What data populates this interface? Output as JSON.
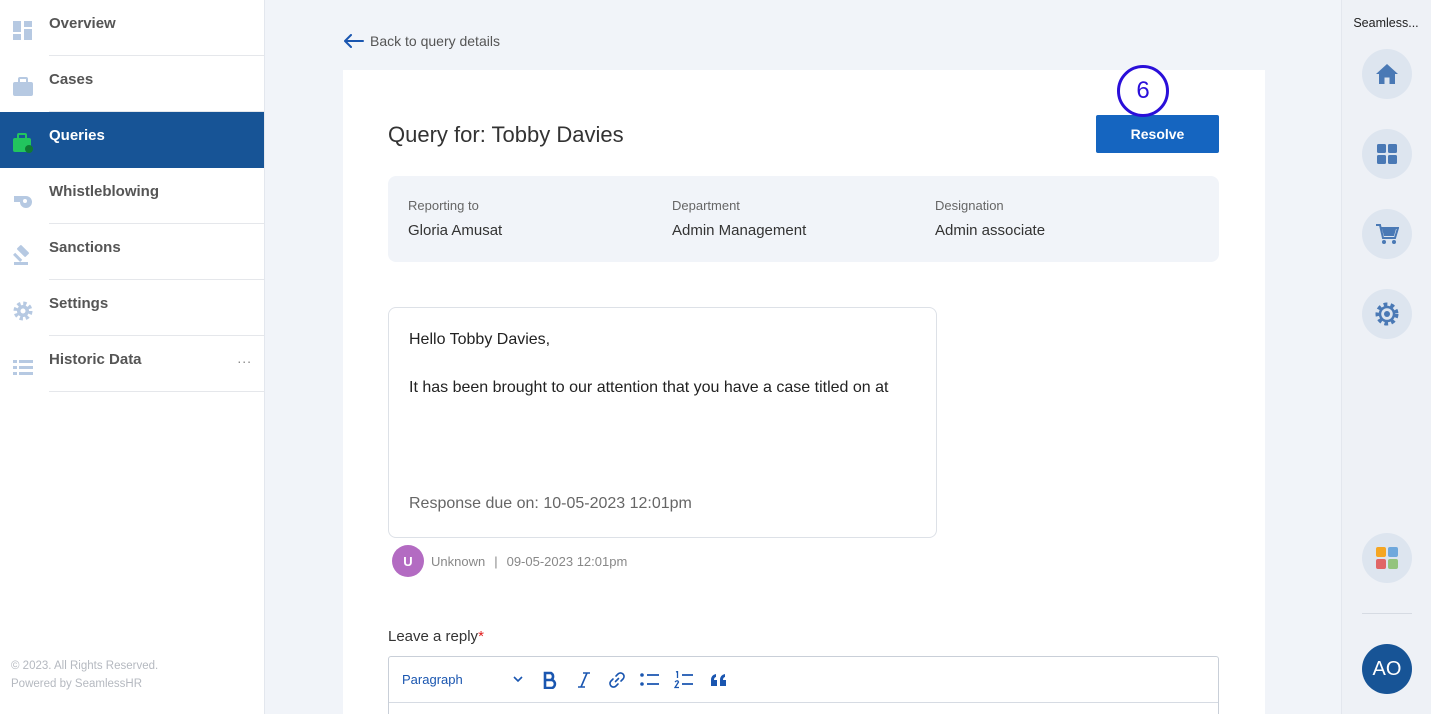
{
  "sidebar": {
    "items": [
      {
        "label": "Overview",
        "icon": "dashboard-icon",
        "active": false
      },
      {
        "label": "Cases",
        "icon": "briefcase-icon",
        "active": false
      },
      {
        "label": "Queries",
        "icon": "query-briefcase-icon",
        "active": true
      },
      {
        "label": "Whistleblowing",
        "icon": "whistle-icon",
        "active": false
      },
      {
        "label": "Sanctions",
        "icon": "gavel-icon",
        "active": false
      },
      {
        "label": "Settings",
        "icon": "gear-icon",
        "active": false
      },
      {
        "label": "Historic Data",
        "icon": "list-icon",
        "active": false,
        "more": "..."
      }
    ],
    "footer": {
      "copyright": "© 2023. All Rights Reserved.",
      "powered": "Powered by SeamlessHR"
    }
  },
  "header": {
    "back_label": "Back to query details"
  },
  "query": {
    "title": "Query for: Tobby Davies",
    "resolve_label": "Resolve",
    "step_badge": "6",
    "info": [
      {
        "label": "Reporting to",
        "value": "Gloria Amusat"
      },
      {
        "label": "Department",
        "value": "Admin Management"
      },
      {
        "label": "Designation",
        "value": "Admin associate"
      }
    ]
  },
  "message": {
    "greeting": "Hello Tobby Davies,",
    "body": "It has been brought to our attention that you have a case titled on at",
    "due": "Response due on: 10-05-2023 12:01pm",
    "sender_initial": "U",
    "sender_name": "Unknown",
    "separator": "|",
    "sent_at": "09-05-2023 12:01pm"
  },
  "reply": {
    "label": "Leave a reply",
    "required_mark": "*",
    "format_select": "Paragraph"
  },
  "rail": {
    "title": "Seamless...",
    "avatar_initials": "AO",
    "buttons": [
      "home-icon",
      "apps-grid-icon",
      "cart-icon",
      "settings-cog-icon",
      "colorful-grid-icon"
    ]
  },
  "colors": {
    "primary": "#175496",
    "button": "#1565c0",
    "badge_ring": "#2a0fd9",
    "sender_avatar": "#b36bc2"
  }
}
